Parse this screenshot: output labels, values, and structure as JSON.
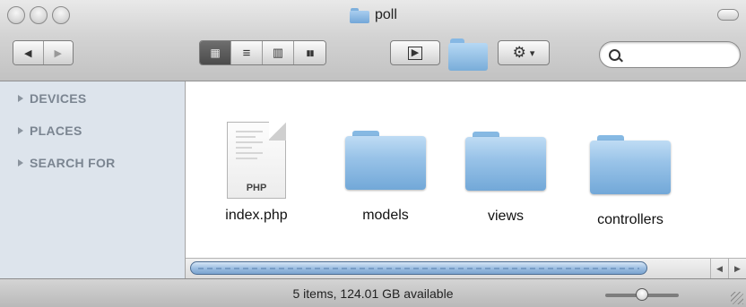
{
  "window": {
    "title": "poll"
  },
  "toolbar": {
    "back_icon": "◀",
    "forward_icon": "▶",
    "view_modes": [
      {
        "name": "icon-view",
        "glyph": "▦",
        "active": true
      },
      {
        "name": "list-view",
        "glyph": "≡",
        "active": false
      },
      {
        "name": "column-view",
        "glyph": "▥",
        "active": false
      },
      {
        "name": "coverflow-view",
        "glyph": "▮▮",
        "active": false
      }
    ],
    "quicklook_glyph": "▶",
    "action_glyph": "⚙",
    "action_caret": "▾",
    "search": {
      "value": "",
      "placeholder": ""
    }
  },
  "sidebar": {
    "sections": [
      {
        "label": "DEVICES"
      },
      {
        "label": "PLACES"
      },
      {
        "label": "SEARCH FOR"
      }
    ]
  },
  "files": [
    {
      "name": "index.php",
      "kind": "document",
      "ext": "PHP"
    },
    {
      "name": "models",
      "kind": "folder"
    },
    {
      "name": "views",
      "kind": "folder"
    },
    {
      "name": "controllers",
      "kind": "folder"
    }
  ],
  "scrollbar": {
    "left_arrow": "◀",
    "right_arrow": "▶"
  },
  "status": {
    "text": "5 items, 124.01 GB available"
  },
  "colors": {
    "folder_blue": "#8fbbe4",
    "sidebar_bg": "#dde4ec",
    "scroll_thumb": "#9ebfe2"
  }
}
